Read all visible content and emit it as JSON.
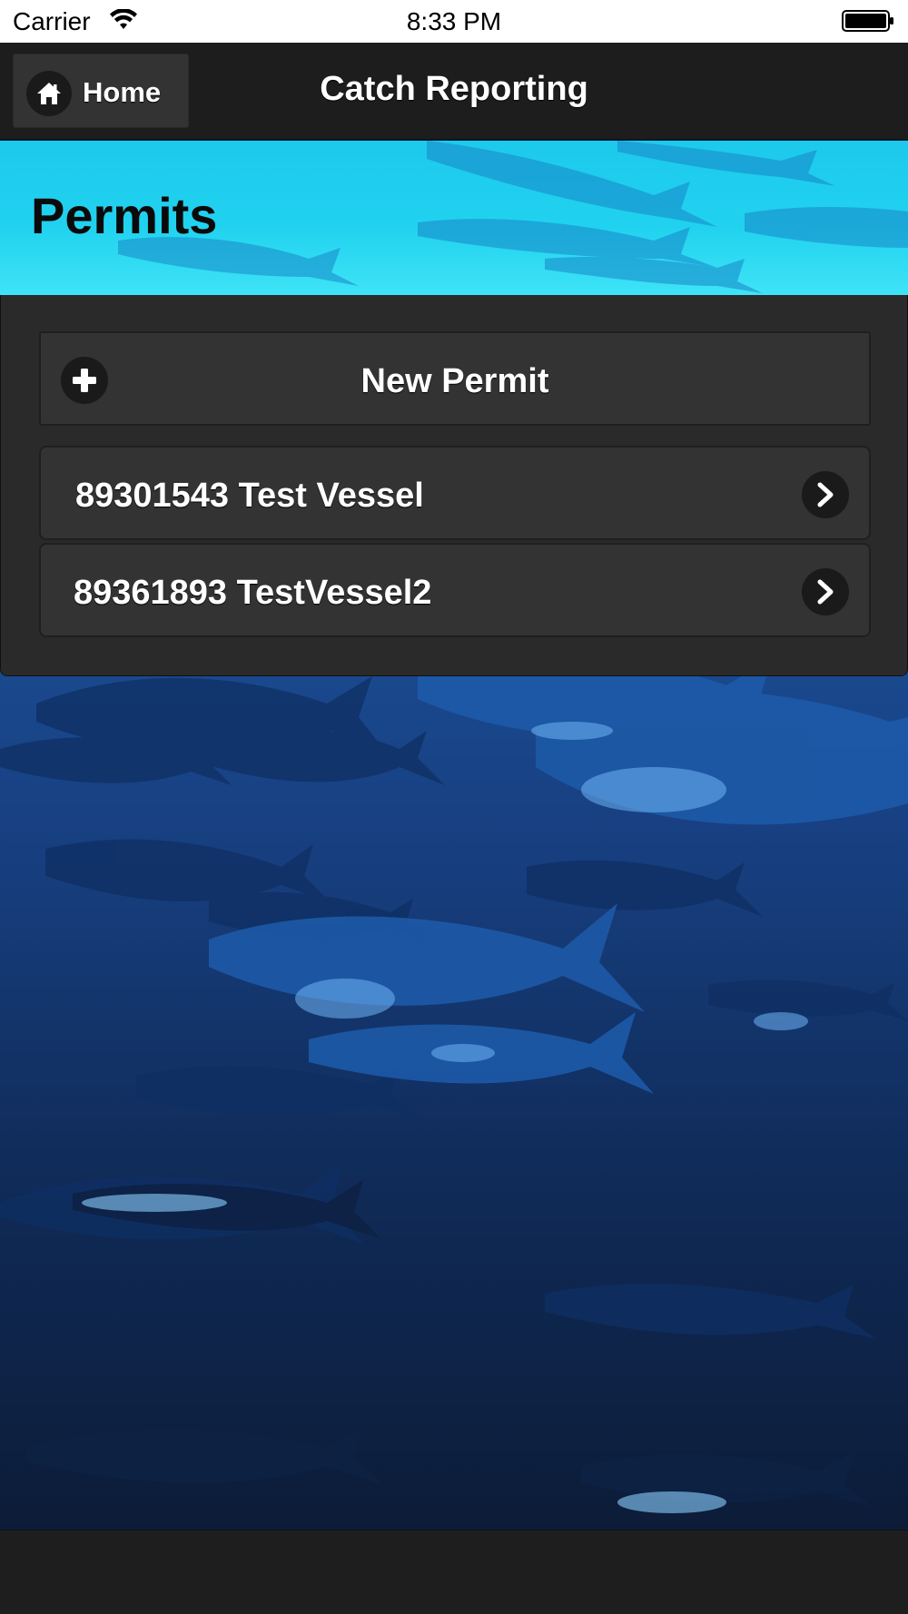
{
  "status_bar": {
    "carrier": "Carrier",
    "time": "8:33 PM"
  },
  "header": {
    "home_label": "Home",
    "title": "Catch Reporting"
  },
  "banner": {
    "title": "Permits"
  },
  "panel": {
    "new_permit_label": "New Permit",
    "permits": [
      {
        "label": "89301543 Test Vessel"
      },
      {
        "label": "89361893 TestVessel2"
      }
    ]
  },
  "icons": {
    "home": "home-icon",
    "add": "plus-icon",
    "navigate": "chevron-right-icon",
    "wifi": "wifi-icon",
    "battery": "battery-icon"
  },
  "colors": {
    "header_bg": "#1d1d1d",
    "button_bg": "#333333",
    "panel_bg": "#2a2a2a",
    "banner_bg": "#20d2ef",
    "ocean_bg": "#1c4f98"
  }
}
